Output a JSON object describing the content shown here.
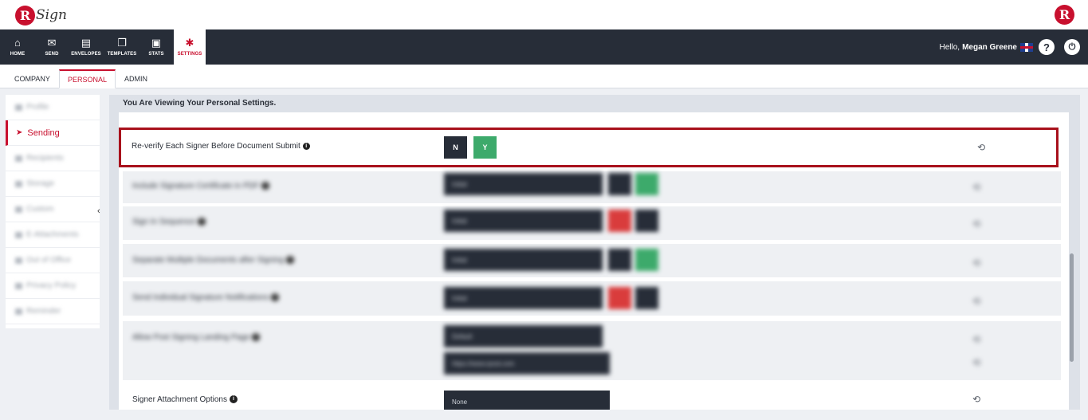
{
  "brand": {
    "logo_letter": "R",
    "logo_word": "Sign"
  },
  "nav": {
    "items": [
      {
        "label": "HOME",
        "icon": "home-icon",
        "glyph": "⌂"
      },
      {
        "label": "SEND",
        "icon": "envelope-icon",
        "glyph": "✉"
      },
      {
        "label": "ENVELOPES",
        "icon": "envelopes-icon",
        "glyph": "▤"
      },
      {
        "label": "TEMPLATES",
        "icon": "templates-icon",
        "glyph": "❐"
      },
      {
        "label": "STATS",
        "icon": "briefcase-icon",
        "glyph": "▣"
      },
      {
        "label": "SETTINGS",
        "icon": "gear-icon",
        "glyph": "✱"
      }
    ],
    "greeting": "Hello,",
    "user_name": "Megan Greene",
    "help_glyph": "?",
    "power_glyph": "⏻"
  },
  "subtabs": [
    "COMPANY",
    "PERSONAL",
    "ADMIN"
  ],
  "sidebar": {
    "items": [
      "Profile",
      "Sending",
      "Recipients",
      "Storage",
      "Custom",
      "E-Attachments",
      "Out of Office",
      "Privacy Policy",
      "Reminder"
    ],
    "active_index": 1
  },
  "main": {
    "title": "You Are Viewing Your Personal Settings.",
    "highlight_row": {
      "label": "Re-verify Each Signer Before Document Submit",
      "btn_n": "N",
      "btn_y": "Y",
      "selected": "Y"
    },
    "rows": [
      {
        "label": "Include Signature Certificate in PDF",
        "dd": "Initial",
        "b1": "",
        "b2": ""
      },
      {
        "label": "Sign In Sequence",
        "dd": "Initial",
        "b1": "",
        "b2": ""
      },
      {
        "label": "Separate Multiple Documents after Signing",
        "dd": "Initial",
        "b1": "",
        "b2": ""
      },
      {
        "label": "Send Individual Signature Notifications",
        "dd": "Initial",
        "b1": "",
        "b2": ""
      },
      {
        "label": "Allow Post Signing Landing Page",
        "dd": "Default",
        "dd2": "https://www.rpost.com"
      }
    ],
    "last_row": {
      "label": "Signer Attachment Options",
      "dd": "None"
    }
  },
  "colors": {
    "accent": "#c8102e",
    "dark": "#272d38",
    "green": "#3daa6b",
    "red": "#d93c3c",
    "highlight": "#a8111c"
  }
}
